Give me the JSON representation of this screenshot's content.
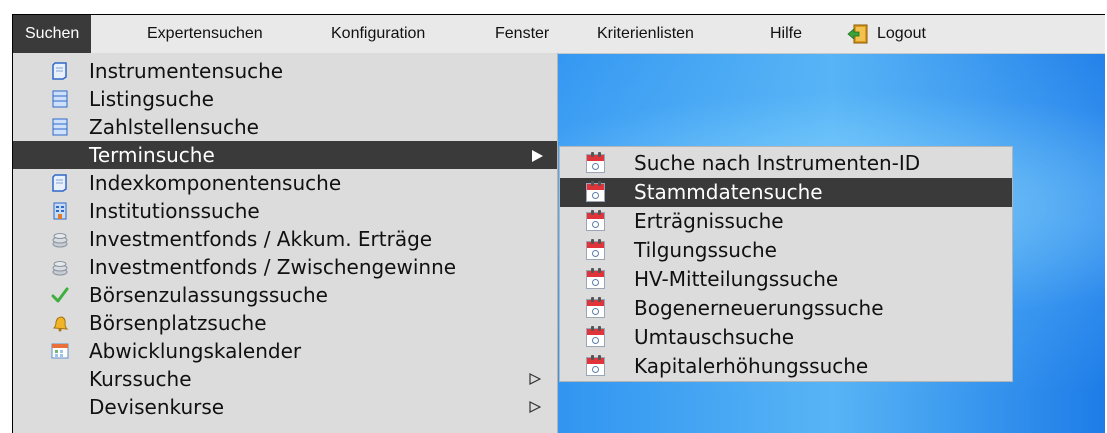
{
  "menubar": {
    "items": [
      "Suchen",
      "Expertensuchen",
      "Konfiguration",
      "Fenster",
      "Kriterienlisten",
      "Hilfe"
    ],
    "logout_label": "Logout"
  },
  "menu_main": {
    "items": [
      {
        "label": "Instrumentensuche",
        "icon": "document-icon"
      },
      {
        "label": "Listingsuche",
        "icon": "stacked-windows-icon"
      },
      {
        "label": "Zahlstellensuche",
        "icon": "stacked-windows-icon"
      },
      {
        "label": "Terminsuche",
        "icon": "none"
      },
      {
        "label": "Indexkomponentensuche",
        "icon": "document-icon"
      },
      {
        "label": "Institutionssuche",
        "icon": "building-icon"
      },
      {
        "label": "Investmentfonds / Akkum. Erträge",
        "icon": "coins-icon"
      },
      {
        "label": "Investmentfonds / Zwischengewinne",
        "icon": "coins-icon"
      },
      {
        "label": "Börsenzulassungssuche",
        "icon": "checkmark-icon"
      },
      {
        "label": "Börsenplatzsuche",
        "icon": "bell-icon"
      },
      {
        "label": "Abwicklungskalender",
        "icon": "calendar-grid-icon"
      },
      {
        "label": "Kurssuche",
        "icon": "none"
      },
      {
        "label": "Devisenkurse",
        "icon": "none"
      }
    ]
  },
  "menu_sub": {
    "items": [
      "Suche nach Instrumenten-ID",
      "Stammdatensuche",
      "Erträgnissuche",
      "Tilgungssuche",
      "HV-Mitteilungssuche",
      "Bogenerneuerungssuche",
      "Umtauschsuche",
      "Kapitalerhöhungssuche"
    ],
    "icon": "calendar-search-icon"
  },
  "colors": {
    "menu_bg": "#dcdcdc",
    "highlight": "#3a3a3a",
    "menubar_bg": "#e9e9e9",
    "desktop": "#2a8ff0"
  }
}
